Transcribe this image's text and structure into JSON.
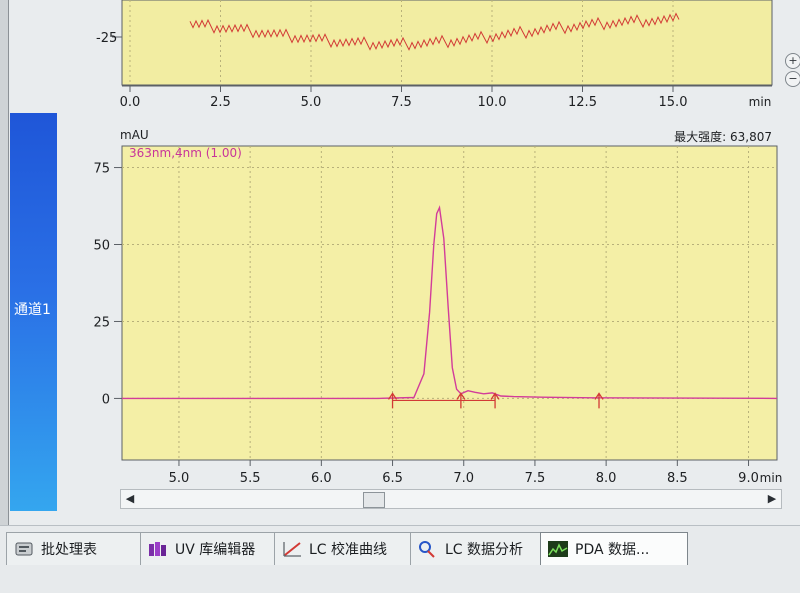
{
  "upper_chart": {
    "x_tick_labels": [
      "0.0",
      "2.5",
      "5.0",
      "7.5",
      "10.0",
      "12.5",
      "15.0"
    ],
    "x_unit": "min",
    "y_tick_labels": [
      "-25"
    ]
  },
  "chart_data": {
    "type": "line",
    "ylabel": "mAU",
    "series_label": "363nm,4nm (1.00)",
    "max_intensity_label": "最大强度: 63,807",
    "x_tick_labels": [
      "5.0",
      "5.5",
      "6.0",
      "6.5",
      "7.0",
      "7.5",
      "8.0",
      "8.5",
      "9.0"
    ],
    "x_unit": "min",
    "y_tick_labels": [
      "75",
      "50",
      "25",
      "0"
    ],
    "xlim": [
      4.6,
      9.2
    ],
    "ylim": [
      -20,
      82
    ],
    "series": [
      {
        "x": [
          4.6,
          6.4,
          6.65,
          6.72,
          6.76,
          6.79,
          6.81,
          6.83,
          6.86,
          6.89,
          6.92,
          6.95,
          6.98,
          7.03,
          7.08,
          7.14,
          7.2,
          7.26,
          7.35,
          7.55,
          7.9,
          9.2
        ],
        "y": [
          0,
          0,
          0.3,
          8,
          28,
          50,
          60,
          62,
          52,
          30,
          10,
          3,
          1.5,
          2.5,
          2,
          1.5,
          1.8,
          0.8,
          0.6,
          0.4,
          0.2,
          0
        ]
      }
    ],
    "peak_markers_x": [
      6.5,
      6.98,
      7.22,
      7.95
    ],
    "grid": true,
    "colors": {
      "line": "#d23c9a",
      "marker": "#d23a35",
      "plot_bg": "#f4efa6"
    }
  },
  "channel_label": "通道1",
  "tabs": [
    {
      "label": "批处理表",
      "icon": "batch-table-icon"
    },
    {
      "label": "UV 库编辑器",
      "icon": "uv-library-icon"
    },
    {
      "label": "LC 校准曲线",
      "icon": "calibration-curve-icon"
    },
    {
      "label": "LC 数据分析",
      "icon": "data-analysis-icon"
    },
    {
      "label": "PDA 数据...",
      "icon": "pda-data-icon"
    }
  ]
}
